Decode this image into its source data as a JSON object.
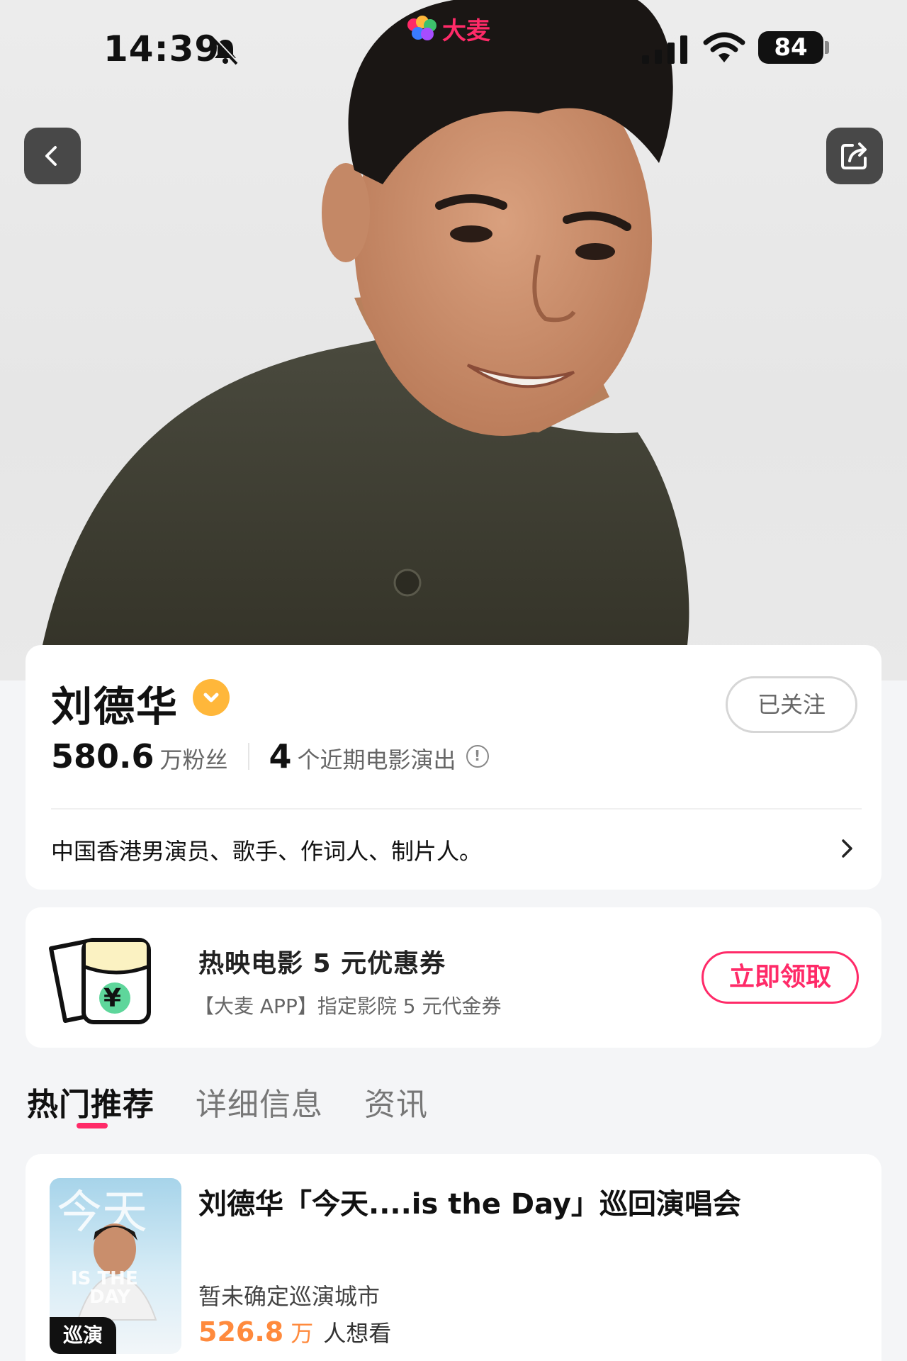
{
  "status_bar": {
    "time": "14:39",
    "brand_logo_text": "大麦",
    "battery": "84",
    "icons": [
      "bell-muted-icon",
      "cellular-signal-icon",
      "wifi-icon",
      "battery-icon"
    ]
  },
  "nav": {
    "back_icon": "chevron-left-icon",
    "share_icon": "share-icon"
  },
  "profile": {
    "name": "刘德华",
    "verified_icon": "verified-badge-icon",
    "follow_label": "已关注",
    "fans_count": "580.6",
    "fans_unit": "万粉丝",
    "shows_count": "4",
    "shows_label": "个近期电影演出",
    "info_icon": "info-circle-icon",
    "bio": "中国香港男演员、歌手、作词人、制片人。"
  },
  "coupon": {
    "title": "热映电影 5 元优惠券",
    "subtitle": "【大麦 APP】指定影院 5 元代金券",
    "claim_label": "立即领取",
    "currency_symbol": "¥"
  },
  "tabs": [
    {
      "label": "热门推荐",
      "active": true
    },
    {
      "label": "详细信息",
      "active": false
    },
    {
      "label": "资讯",
      "active": false
    }
  ],
  "event": {
    "title": "刘德华「今天....is the Day」巡回演唱会",
    "tag": "巡演",
    "city": "暂未确定巡演城市",
    "want_count": "526.8",
    "want_unit": "万",
    "want_label": "人想看"
  },
  "colors": {
    "accent": "#ff2a68",
    "verified": "#ffb73a",
    "want": "#ff8a3d"
  }
}
